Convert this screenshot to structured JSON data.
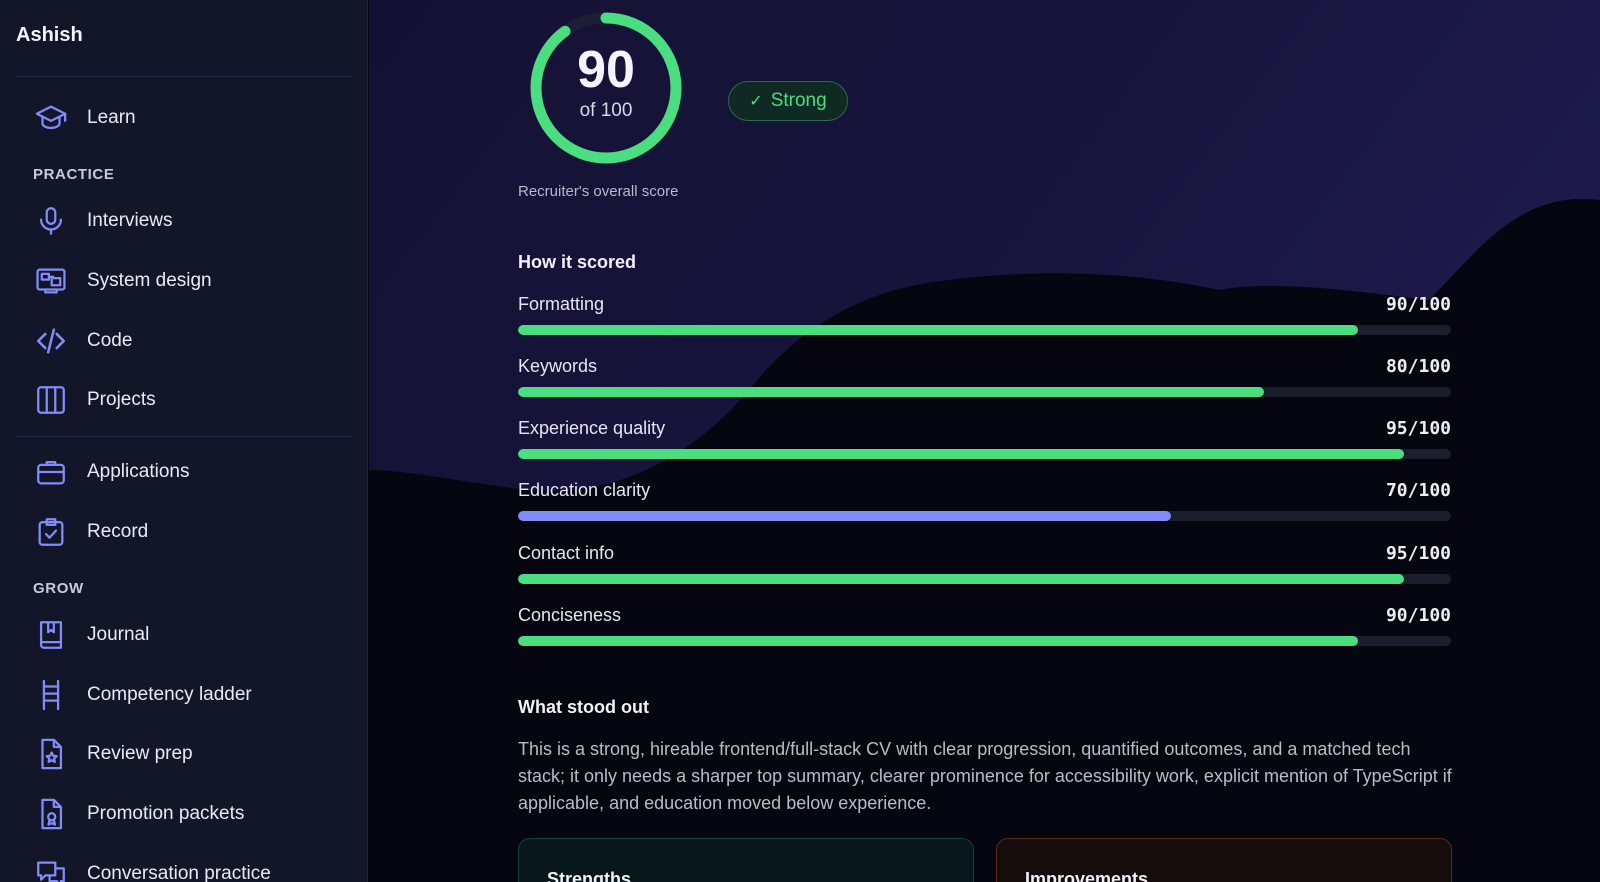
{
  "user": {
    "name": "Ashish"
  },
  "nav": {
    "top": [
      {
        "label": "Learn",
        "icon": "graduation-cap-icon"
      }
    ],
    "practice_label": "PRACTICE",
    "practice": [
      {
        "label": "Interviews",
        "icon": "microphone-icon"
      },
      {
        "label": "System design",
        "icon": "system-design-icon"
      },
      {
        "label": "Code",
        "icon": "code-icon"
      },
      {
        "label": "Projects",
        "icon": "columns-icon"
      }
    ],
    "tracking": [
      {
        "label": "Applications",
        "icon": "briefcase-icon"
      },
      {
        "label": "Record",
        "icon": "clipboard-check-icon"
      }
    ],
    "grow_label": "GROW",
    "grow": [
      {
        "label": "Journal",
        "icon": "journal-bookmark-icon"
      },
      {
        "label": "Competency ladder",
        "icon": "ladder-icon"
      },
      {
        "label": "Review prep",
        "icon": "file-star-icon"
      },
      {
        "label": "Promotion packets",
        "icon": "file-badge-icon"
      },
      {
        "label": "Conversation practice",
        "icon": "chat-bubbles-icon"
      }
    ]
  },
  "overall": {
    "score": "90",
    "out_of": "of 100",
    "fraction": 0.9,
    "badge": "Strong",
    "caption": "Recruiter's overall score"
  },
  "breakdown": {
    "title": "How it scored",
    "items": [
      {
        "name": "Formatting",
        "value": "90/100",
        "fraction": 0.9,
        "color": "#4ade80"
      },
      {
        "name": "Keywords",
        "value": "80/100",
        "fraction": 0.8,
        "color": "#4ade80"
      },
      {
        "name": "Experience quality",
        "value": "95/100",
        "fraction": 0.95,
        "color": "#4ade80"
      },
      {
        "name": "Education clarity",
        "value": "70/100",
        "fraction": 0.7,
        "color": "#818cf8"
      },
      {
        "name": "Contact info",
        "value": "95/100",
        "fraction": 0.95,
        "color": "#4ade80"
      },
      {
        "name": "Conciseness",
        "value": "90/100",
        "fraction": 0.9,
        "color": "#4ade80"
      }
    ]
  },
  "standout": {
    "title": "What stood out",
    "text": "This is a strong, hireable frontend/full-stack CV with clear progression, quantified outcomes, and a matched tech stack; it only needs a sharper top summary, clearer prominence for accessibility work, explicit mention of TypeScript if applicable, and education moved below experience."
  },
  "cards": {
    "strengths": "Strengths",
    "improvements": "Improvements"
  },
  "colors": {
    "accent": "#818cf8",
    "success": "#4ade80",
    "sidebar_bg": "#121628"
  }
}
